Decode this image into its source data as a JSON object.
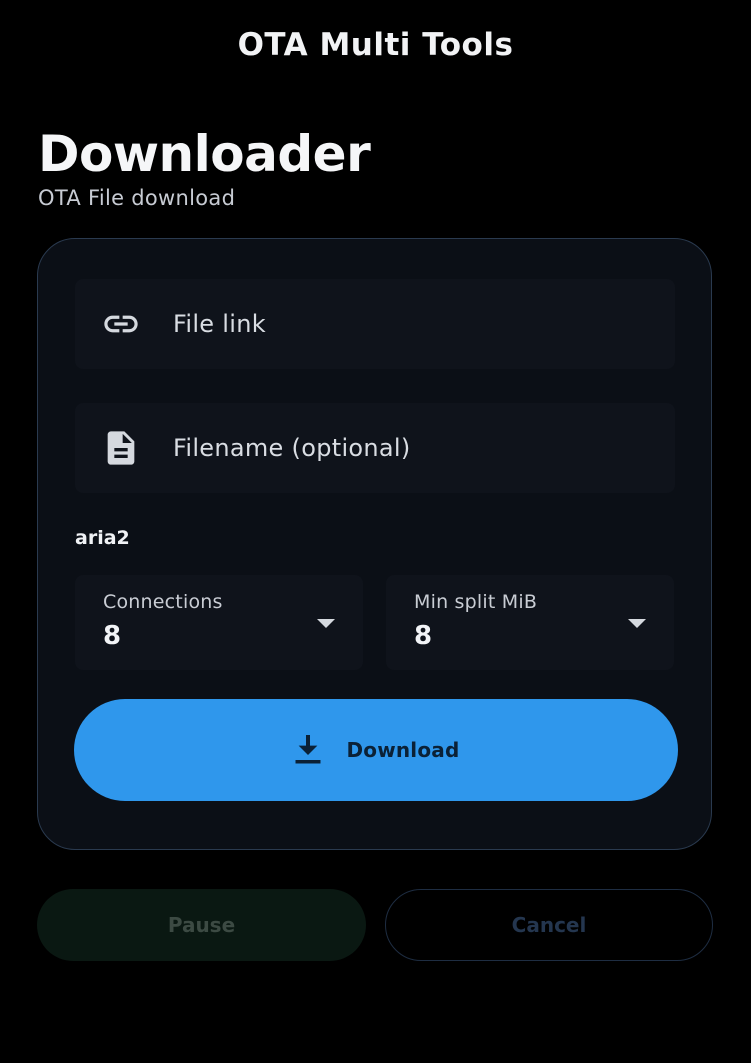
{
  "app_bar": {
    "title": "OTA Multi Tools"
  },
  "page": {
    "title": "Downloader",
    "subtitle": "OTA File download"
  },
  "form": {
    "file_link": {
      "placeholder": "File link",
      "icon": "link-icon"
    },
    "filename": {
      "placeholder": "Filename (optional)",
      "icon": "document-icon"
    },
    "section_label": "aria2",
    "connections": {
      "label": "Connections",
      "value": "8"
    },
    "min_split": {
      "label": "Min split MiB",
      "value": "8"
    },
    "download_button": {
      "label": "Download",
      "icon": "download-icon",
      "color": "#2f97ec"
    }
  },
  "actions": {
    "pause_label": "Pause",
    "cancel_label": "Cancel"
  },
  "colors": {
    "background": "#000000",
    "card_border": "#2a3a4f",
    "accent": "#2f97ec"
  }
}
